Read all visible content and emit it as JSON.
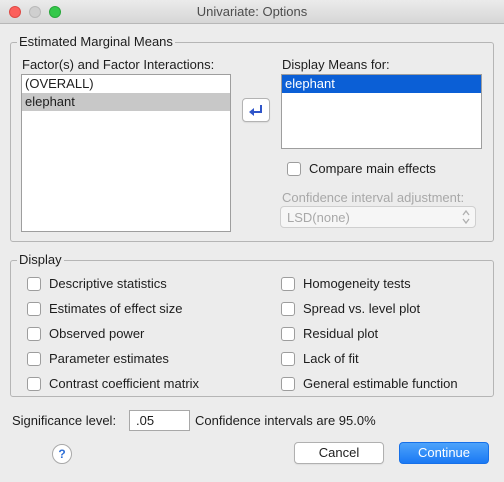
{
  "window": {
    "title": "Univariate: Options"
  },
  "emm": {
    "legend": "Estimated Marginal Means",
    "factors_label": "Factor(s) and Factor Interactions:",
    "factors": [
      "(OVERALL)",
      "elephant"
    ],
    "display_label": "Display Means for:",
    "display_items": [
      "elephant"
    ],
    "compare_label": "Compare main effects",
    "ci_adj_label": "Confidence interval adjustment:",
    "ci_adj_value": "LSD(none)"
  },
  "display": {
    "legend": "Display",
    "left": [
      "Descriptive statistics",
      "Estimates of effect size",
      "Observed power",
      "Parameter estimates",
      "Contrast coefficient matrix"
    ],
    "right": [
      "Homogeneity tests",
      "Spread vs. level plot",
      "Residual plot",
      "Lack of fit",
      "General estimable function"
    ]
  },
  "significance": {
    "label": "Significance level:",
    "value": ".05",
    "ci_text": "Confidence intervals are 95.0%"
  },
  "buttons": {
    "help": "?",
    "cancel": "Cancel",
    "continue": "Continue"
  }
}
